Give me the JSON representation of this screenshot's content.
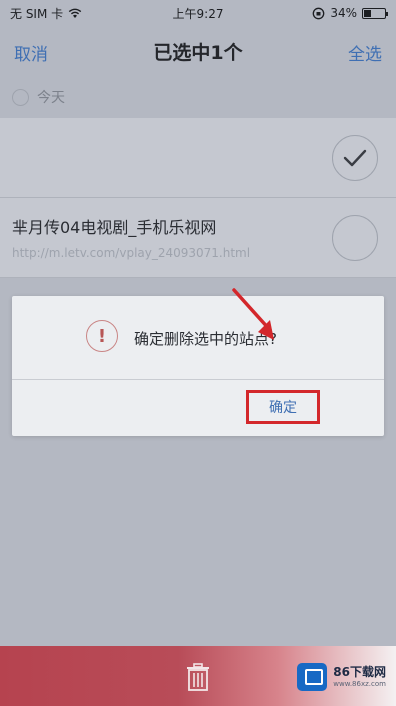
{
  "status_bar": {
    "carrier": "无 SIM 卡",
    "time": "上午9:27",
    "battery_percent": "34%",
    "battery_level": 0.34,
    "icons": [
      "wifi-icon",
      "orientation-lock-icon",
      "battery-icon"
    ]
  },
  "nav": {
    "cancel_label": "取消",
    "title": "已选中1个",
    "select_all_label": "全选"
  },
  "section": {
    "header": "今天"
  },
  "list": {
    "items": [
      {
        "title": "",
        "url": "",
        "selected": true
      },
      {
        "title": "芈月传04电视剧_手机乐视网",
        "url": "http://m.letv.com/vplay_24093071.html",
        "selected": false
      }
    ]
  },
  "dialog": {
    "message": "确定删除选中的站点?",
    "confirm_label": "确定"
  },
  "toolbar": {
    "icon": "trash-icon"
  },
  "watermark": {
    "text": "86下载网",
    "sub": "www.86xz.com"
  },
  "colors": {
    "accent": "#3f6fb3",
    "highlight_box": "#d3272b",
    "toolbar": "#b6434f"
  }
}
